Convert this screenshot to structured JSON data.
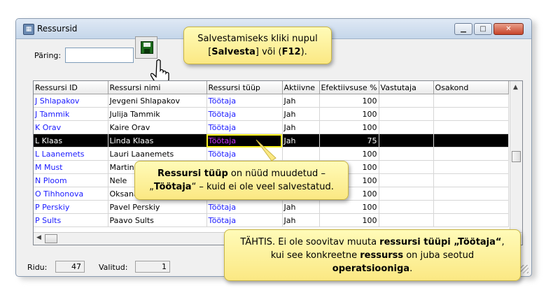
{
  "window": {
    "title": "Ressursid"
  },
  "query": {
    "label": "Päring:",
    "value": ""
  },
  "grid": {
    "columns": [
      "Ressursi ID",
      "Ressursi nimi",
      "Ressursi tüüp",
      "Aktiivne",
      "Efektiivsuse %",
      "Vastutaja",
      "Osakond"
    ],
    "rows": [
      {
        "id": "J Shlapakov",
        "name": "Jevgeni Shlapakov",
        "type": "Töötaja",
        "active": "Jah",
        "eff": "100"
      },
      {
        "id": "J Tammik",
        "name": "Julija Tammik",
        "type": "Töötaja",
        "active": "Jah",
        "eff": "100"
      },
      {
        "id": "K Orav",
        "name": "Kaire Orav",
        "type": "Töötaja",
        "active": "Jah",
        "eff": "100"
      },
      {
        "id": "L Klaas",
        "name": "Linda Klaas",
        "type": "Töötaja",
        "active": "Jah",
        "eff": "75"
      },
      {
        "id": "L Laanemets",
        "name": "Lauri Laanemets",
        "type": "Töötaja",
        "active": "",
        "eff": "100"
      },
      {
        "id": "M Must",
        "name": "Martin Must",
        "type": "",
        "active": "",
        "eff": "100"
      },
      {
        "id": "N Ploom",
        "name": "Nele",
        "type": "",
        "active": "",
        "eff": "100"
      },
      {
        "id": "O Tihhonova",
        "name": "Oksana",
        "type": "",
        "active": "",
        "eff": "100"
      },
      {
        "id": "P Perskiy",
        "name": "Pavel Perskiy",
        "type": "Töötaja",
        "active": "Jah",
        "eff": "100"
      },
      {
        "id": "P Sults",
        "name": "Paavo Sults",
        "type": "Töötaja",
        "active": "Jah",
        "eff": "100"
      }
    ],
    "selected_row": 3
  },
  "status": {
    "rows_label": "Ridu:",
    "rows_value": "47",
    "selected_label": "Valitud:",
    "selected_value": "1"
  },
  "callouts": {
    "save": {
      "text1": "Salvestamiseks kliki nupul",
      "text2a": "[",
      "text2b": "Salvesta",
      "text2c": "] või (",
      "text2d": "F12",
      "text2e": ")."
    },
    "changed": {
      "bold1": "Ressursi tüüp",
      "text1": " on nüüd muudetud –",
      "text2a": "„",
      "bold2": "Töötaja",
      "text2b": "“ – kuid ei ole veel salvestatud."
    },
    "important": {
      "text1": "TÄHTIS. Ei ole soovitav muuta ",
      "bold1": "ressursi tüüpi „Töötaja“",
      "text1b": ",",
      "text2": "kui see konkreetne ",
      "bold2": "ressurss",
      "text2b": " on juba seotud",
      "bold3": "operatsiooniga",
      "text3b": "."
    }
  },
  "colors": {
    "link": "#1a1aff",
    "selection": "#000000",
    "highlight_type": "#cc33ff",
    "callout": "#fbe883"
  }
}
